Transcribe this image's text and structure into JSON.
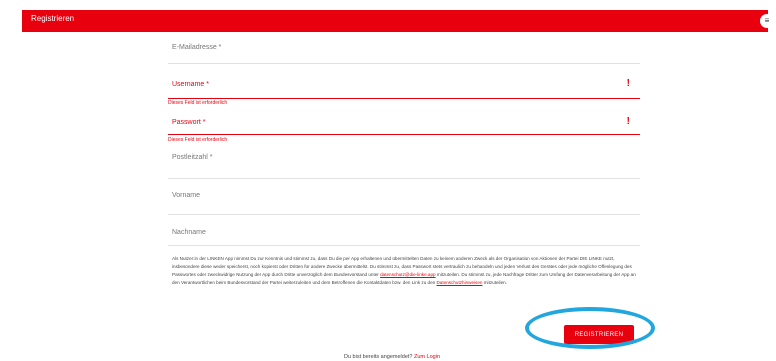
{
  "header": {
    "title": "Registrieren",
    "menu_icon": "≡"
  },
  "form": {
    "email": {
      "label": "E-Mailadresse *"
    },
    "username": {
      "label": "Username *",
      "error": "Dieses Feld ist erforderlich",
      "error_icon": "!"
    },
    "password": {
      "label": "Passwort *",
      "error": "Dieses Feld ist erforderlich",
      "error_icon": "!"
    },
    "postcode": {
      "label": "Postleitzahl *"
    },
    "firstname": {
      "label": "Vorname"
    },
    "lastname": {
      "label": "Nachname"
    }
  },
  "terms": {
    "text1": "Als Nutzer:in der LINKEN App nimmst Du zur Kenntnis und stimmst zu, dass Du die per App erhaltenen und übermittelten Daten zu keinem anderen Zweck als der Organisation von Aktionen der Partei DIE LINKE nutzt, insbesondere diese weder speicherst, noch kopierst oder Dritten für andere Zwecke übermittelst. Du stimmst zu, dass Passwort stets vertraulich zu behandeln und jeden Verlust des Gerätes oder jede mögliche Offenlegung des Passwortes oder zweckwidrige Nutzung der App durch Dritte unverzüglich dem Bundesvorstand unter",
    "email_link": "datenschutz@die-linke.app",
    "text2": "mitzuteilen. Du stimmst zu, jede Nachfrage Dritter zum Umfang der Datenverarbeitung der App an den Verantwortlichen beim Bundesvorstand der Partei weiterzuleiten und dem Betroffenen die Kontaktdaten bzw. den Link zu den",
    "privacy_link": "Datenschutzhinweisen",
    "text3": "mitzuteilen."
  },
  "submit_label": "REGISTRIEREN",
  "login": {
    "text": "Du bist bereits angemeldet?",
    "link": "Zum Login"
  },
  "colors": {
    "accent": "#e8000f",
    "highlight_ring": "#21a6dd"
  }
}
